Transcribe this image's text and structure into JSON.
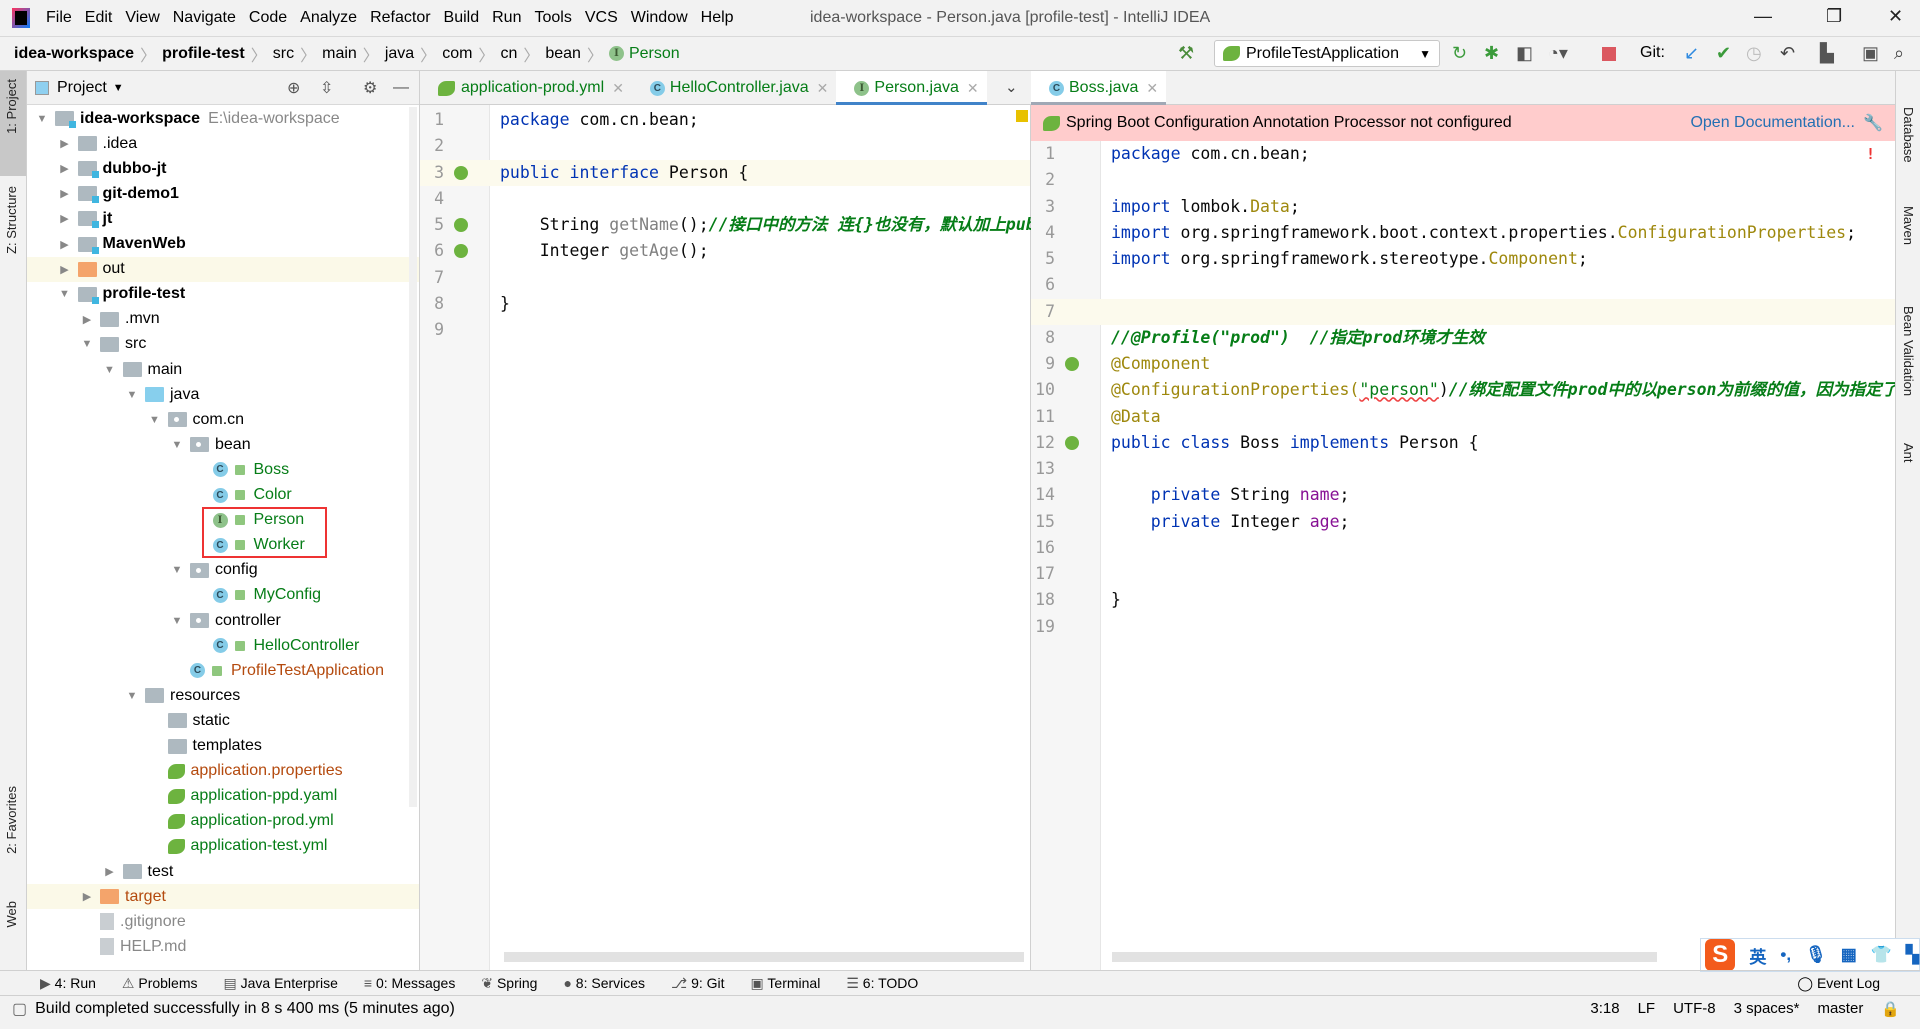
{
  "menu": [
    "File",
    "Edit",
    "View",
    "Navigate",
    "Code",
    "Analyze",
    "Refactor",
    "Build",
    "Run",
    "Tools",
    "VCS",
    "Window",
    "Help"
  ],
  "window_title": "idea-workspace - Person.java [profile-test] - IntelliJ IDEA",
  "breadcrumb": [
    {
      "label": "idea-workspace",
      "bold": true
    },
    {
      "label": "profile-test",
      "bold": true
    },
    {
      "label": "src"
    },
    {
      "label": "main"
    },
    {
      "label": "java"
    },
    {
      "label": "com"
    },
    {
      "label": "cn"
    },
    {
      "label": "bean"
    },
    {
      "label": "Person",
      "icon": "interface"
    }
  ],
  "toolbar": {
    "run_config": "ProfileTestApplication",
    "git_label": "Git:"
  },
  "left_strip": {
    "project": "1: Project",
    "structure": "Z: Structure",
    "favorites": "2: Favorites",
    "web": "Web"
  },
  "right_strip": {
    "database": "Database",
    "maven": "Maven",
    "bean_validation": "Bean Validation",
    "ant": "Ant"
  },
  "project_panel": {
    "title": "Project",
    "tree": [
      {
        "d": 0,
        "label": "idea-workspace",
        "extra": "E:\\idea-workspace",
        "icon": "module",
        "arrow": "open",
        "bold": true
      },
      {
        "d": 1,
        "label": ".idea",
        "icon": "folder",
        "arrow": "closed"
      },
      {
        "d": 1,
        "label": "dubbo-jt",
        "icon": "module",
        "arrow": "closed",
        "bold": true
      },
      {
        "d": 1,
        "label": "git-demo1",
        "icon": "module",
        "arrow": "closed",
        "bold": true
      },
      {
        "d": 1,
        "label": "jt",
        "icon": "module",
        "arrow": "closed",
        "bold": true
      },
      {
        "d": 1,
        "label": "MavenWeb",
        "icon": "module",
        "arrow": "closed",
        "bold": true
      },
      {
        "d": 1,
        "label": "out",
        "icon": "excluded",
        "arrow": "closed",
        "hl": true
      },
      {
        "d": 1,
        "label": "profile-test",
        "icon": "module",
        "arrow": "open",
        "bold": true
      },
      {
        "d": 2,
        "label": ".mvn",
        "icon": "folder",
        "arrow": "closed"
      },
      {
        "d": 2,
        "label": "src",
        "icon": "folder",
        "arrow": "open"
      },
      {
        "d": 3,
        "label": "main",
        "icon": "folder",
        "arrow": "open"
      },
      {
        "d": 4,
        "label": "java",
        "icon": "source",
        "arrow": "open"
      },
      {
        "d": 5,
        "label": "com.cn",
        "icon": "package",
        "arrow": "open"
      },
      {
        "d": 6,
        "label": "bean",
        "icon": "package",
        "arrow": "open"
      },
      {
        "d": 7,
        "label": "Boss",
        "icon": "class",
        "color": "green"
      },
      {
        "d": 7,
        "label": "Color",
        "icon": "class",
        "color": "green"
      },
      {
        "d": 7,
        "label": "Person",
        "icon": "interface",
        "color": "green"
      },
      {
        "d": 7,
        "label": "Worker",
        "icon": "class",
        "color": "green"
      },
      {
        "d": 6,
        "label": "config",
        "icon": "package",
        "arrow": "open"
      },
      {
        "d": 7,
        "label": "MyConfig",
        "icon": "class",
        "color": "green"
      },
      {
        "d": 6,
        "label": "controller",
        "icon": "package",
        "arrow": "open"
      },
      {
        "d": 7,
        "label": "HelloController",
        "icon": "class",
        "color": "green"
      },
      {
        "d": 6,
        "label": "ProfileTestApplication",
        "icon": "class",
        "color": "orange"
      },
      {
        "d": 4,
        "label": "resources",
        "icon": "folder",
        "arrow": "open"
      },
      {
        "d": 5,
        "label": "static",
        "icon": "folder"
      },
      {
        "d": 5,
        "label": "templates",
        "icon": "folder"
      },
      {
        "d": 5,
        "label": "application.properties",
        "icon": "spring",
        "color": "orange"
      },
      {
        "d": 5,
        "label": "application-ppd.yaml",
        "icon": "spring",
        "color": "green"
      },
      {
        "d": 5,
        "label": "application-prod.yml",
        "icon": "spring",
        "color": "green"
      },
      {
        "d": 5,
        "label": "application-test.yml",
        "icon": "spring",
        "color": "green"
      },
      {
        "d": 3,
        "label": "test",
        "icon": "folder",
        "arrow": "closed"
      },
      {
        "d": 2,
        "label": "target",
        "icon": "excluded",
        "arrow": "closed",
        "hl": true,
        "color": "orange"
      },
      {
        "d": 2,
        "label": ".gitignore",
        "icon": "file",
        "color": "grey"
      },
      {
        "d": 2,
        "label": "HELP.md",
        "icon": "file",
        "color": "grey"
      }
    ]
  },
  "left_tabs": [
    {
      "label": "application-prod.yml",
      "icon": "spring"
    },
    {
      "label": "HelloController.java",
      "icon": "class"
    },
    {
      "label": "Person.java",
      "icon": "interface",
      "active": true
    }
  ],
  "right_tabs": [
    {
      "label": "Boss.java",
      "icon": "class",
      "active": true
    }
  ],
  "banner": {
    "text": "Spring Boot Configuration Annotation Processor not configured",
    "link": "Open Documentation..."
  },
  "left_code": [
    [
      [
        "package ",
        "kw"
      ],
      [
        "com.cn.bean;",
        "pl"
      ]
    ],
    [],
    [
      [
        "public ",
        "kw"
      ],
      [
        "interface ",
        "kw"
      ],
      [
        "Person {",
        "pl"
      ]
    ],
    [],
    [
      [
        "    String ",
        "pl"
      ],
      [
        "getName",
        "mth"
      ],
      [
        "();",
        "pl"
      ],
      [
        "//接口中的方法 连{}也没有，默认加上publ",
        "cm"
      ]
    ],
    [
      [
        "    Integer ",
        "pl"
      ],
      [
        "getAge",
        "mth"
      ],
      [
        "();",
        "pl"
      ]
    ],
    [],
    [
      [
        "}",
        "pl"
      ]
    ],
    []
  ],
  "right_code": [
    [
      [
        "package ",
        "kw"
      ],
      [
        "com.cn.bean;",
        "pl"
      ]
    ],
    [],
    [
      [
        "import ",
        "kw"
      ],
      [
        "lombok.",
        "pl"
      ],
      [
        "Data",
        "ann"
      ],
      [
        ";",
        "pl"
      ]
    ],
    [
      [
        "import ",
        "kw"
      ],
      [
        "org.springframework.boot.context.properties.",
        "pl"
      ],
      [
        "ConfigurationProperties",
        "ann"
      ],
      [
        ";",
        "pl"
      ]
    ],
    [
      [
        "import ",
        "kw"
      ],
      [
        "org.springframework.stereotype.",
        "pl"
      ],
      [
        "Component",
        "ann"
      ],
      [
        ";",
        "pl"
      ]
    ],
    [],
    [],
    [
      [
        "//@Profile(\"prod\")  //指定prod环境才生效",
        "cm"
      ]
    ],
    [
      [
        "@Component",
        "ann"
      ]
    ],
    [
      [
        "@ConfigurationProperties(",
        "ann"
      ],
      [
        "\"person\"",
        "str"
      ],
      [
        ")",
        "pl"
      ],
      [
        "//绑定配置文件prod中的以person为前缀的值，因为指定了p",
        "cm"
      ]
    ],
    [
      [
        "@Data",
        "ann"
      ]
    ],
    [
      [
        "public ",
        "kw"
      ],
      [
        "class ",
        "kw"
      ],
      [
        "Boss ",
        "pl"
      ],
      [
        "implements ",
        "kw"
      ],
      [
        "Person {",
        "pl"
      ]
    ],
    [],
    [
      [
        "    private ",
        "kw"
      ],
      [
        "String ",
        "pl"
      ],
      [
        "name",
        "fld"
      ],
      [
        ";",
        "pl"
      ]
    ],
    [
      [
        "    private ",
        "kw"
      ],
      [
        "Integer ",
        "pl"
      ],
      [
        "age",
        "fld"
      ],
      [
        ";",
        "pl"
      ]
    ],
    [],
    [],
    [
      [
        "}",
        "pl"
      ]
    ],
    []
  ],
  "bottom_tools": [
    "4: Run",
    "Problems",
    "Java Enterprise",
    "0: Messages",
    "Spring",
    "8: Services",
    "9: Git",
    "Terminal",
    "6: TODO"
  ],
  "event_log": "Event Log",
  "status": {
    "message": "Build completed successfully in 8 s 400 ms (5 minutes ago)",
    "position": "3:18",
    "line_sep": "LF",
    "encoding": "UTF-8",
    "indent": "3 spaces*",
    "branch": "master"
  },
  "ime": {
    "lang": "英"
  },
  "colors": {
    "accent": "#4083c9",
    "banner": "#ffcccc",
    "highlight_box": "#ee3333"
  }
}
